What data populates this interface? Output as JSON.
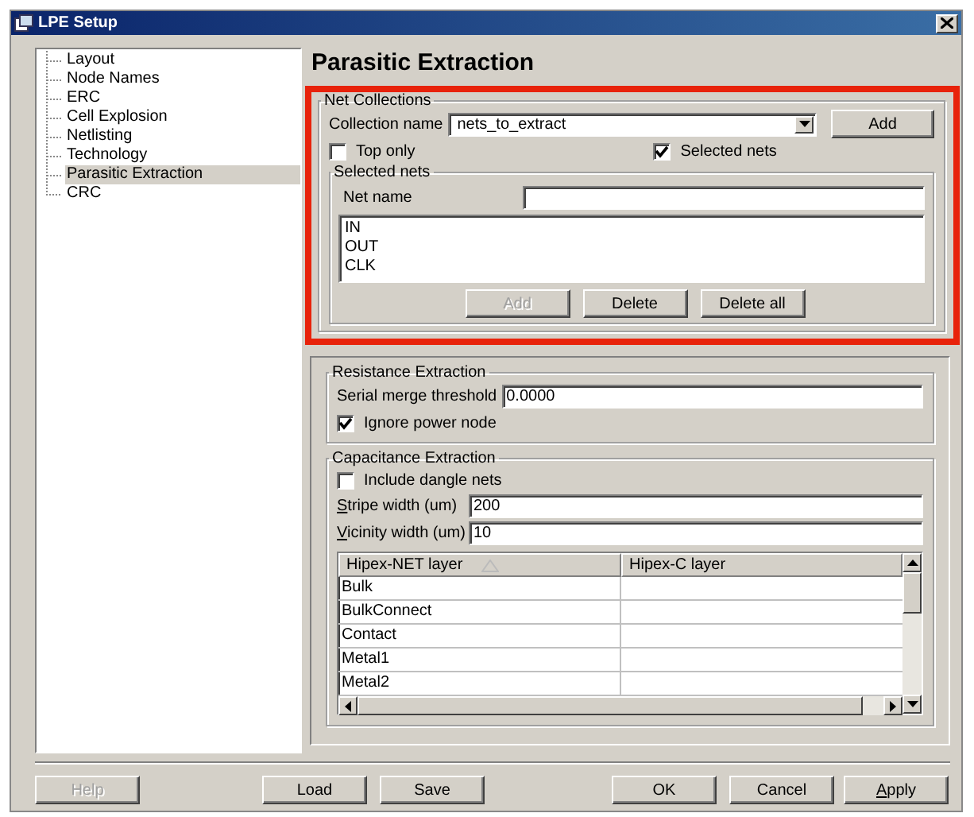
{
  "window": {
    "title": "LPE Setup"
  },
  "tree": {
    "items": [
      {
        "label": "Layout",
        "selected": false
      },
      {
        "label": "Node Names",
        "selected": false
      },
      {
        "label": "ERC",
        "selected": false
      },
      {
        "label": "Cell Explosion",
        "selected": false
      },
      {
        "label": "Netlisting",
        "selected": false
      },
      {
        "label": "Technology",
        "selected": false
      },
      {
        "label": "Parasitic Extraction",
        "selected": true
      },
      {
        "label": "CRC",
        "selected": false
      }
    ]
  },
  "page_title": "Parasitic Extraction",
  "net_collections": {
    "title": "Net Collections",
    "highlighted": true,
    "collection_label": "Collection name",
    "collection_value": "nets_to_extract",
    "add_button": "Add",
    "top_only": {
      "label": "Top only",
      "checked": false
    },
    "selected_nets_check": {
      "label": "Selected nets",
      "checked": true
    },
    "selected_nets": {
      "title": "Selected nets",
      "net_name_label": "Net name",
      "nets": [
        "IN",
        "OUT",
        "CLK"
      ],
      "buttons": [
        {
          "label": "Add",
          "disabled": true
        },
        {
          "label": "Delete",
          "disabled": false
        },
        {
          "label": "Delete all",
          "disabled": false
        }
      ]
    }
  },
  "resistance": {
    "title": "Resistance Extraction",
    "threshold_label": "Serial merge threshold",
    "threshold_value": "0.0000",
    "ignore_power": {
      "label": "Ignore power node",
      "checked": true
    }
  },
  "capacitance": {
    "title": "Capacitance Extraction",
    "include_dangle": {
      "label": "Include dangle nets",
      "checked": false
    },
    "stripe_label": {
      "text": "Stripe width (um)",
      "mnemonic": true
    },
    "stripe_value": "200",
    "vicinity_label": {
      "text": "Vicinity width (um)",
      "mnemonic": true
    },
    "vicinity_value": "10",
    "table": {
      "columns": [
        "Hipex-NET layer",
        "Hipex-C layer"
      ],
      "rows": [
        {
          "hipex_net": "Bulk"
        },
        {
          "hipex_net": "BulkConnect"
        },
        {
          "hipex_net": "Contact"
        },
        {
          "hipex_net": "Metal1"
        },
        {
          "hipex_net": "Metal2"
        }
      ]
    }
  },
  "buttons": [
    {
      "label": "Help",
      "disabled": true,
      "mnemonic": false
    },
    {
      "label": "Load",
      "disabled": false,
      "mnemonic": false
    },
    {
      "label": "Save",
      "disabled": false,
      "mnemonic": false
    },
    {
      "label": "OK",
      "disabled": false,
      "mnemonic": false
    },
    {
      "label": "Cancel",
      "disabled": false,
      "mnemonic": false
    },
    {
      "label": "Apply",
      "disabled": false,
      "mnemonic": true
    }
  ]
}
